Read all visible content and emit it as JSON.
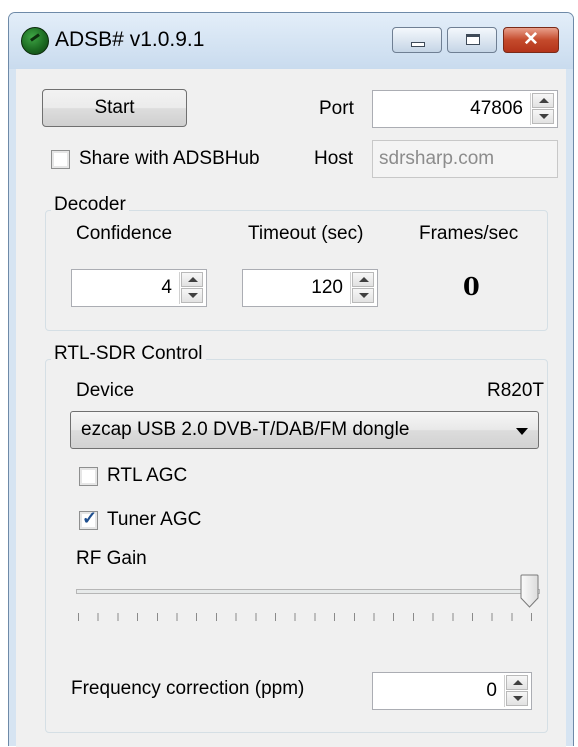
{
  "window": {
    "title": "ADSB# v1.0.9.1",
    "close_glyph": "✕",
    "icons": [
      "app-globe-icon",
      "minimize-icon",
      "maximize-icon",
      "close-icon"
    ]
  },
  "controls": {
    "start_label": "Start",
    "port_label": "Port",
    "port_value": "47806",
    "share_label": "Share with ADSBHub",
    "share_checked": false,
    "host_label": "Host",
    "host_value": "sdrsharp.com"
  },
  "decoder": {
    "group_title": "Decoder",
    "confidence_label": "Confidence",
    "confidence_value": "4",
    "timeout_label": "Timeout (sec)",
    "timeout_value": "120",
    "fps_label": "Frames/sec",
    "fps_value": "0"
  },
  "rtl": {
    "group_title": "RTL-SDR Control",
    "device_label": "Device",
    "tuner": "R820T",
    "device_selected": "ezcap USB 2.0 DVB-T/DAB/FM dongle",
    "rtl_agc_label": "RTL AGC",
    "rtl_agc_checked": false,
    "tuner_agc_label": "Tuner AGC",
    "tuner_agc_checked": true,
    "tuner_agc_tick": "✓",
    "rf_gain_label": "RF Gain",
    "rf_gain_level": 1.0,
    "freq_label": "Frequency correction (ppm)",
    "freq_value": "0"
  },
  "colors": {
    "title_bar": "#c9dbee",
    "client_bg": "#f0f0f0",
    "close_button": "#c44a2c"
  }
}
